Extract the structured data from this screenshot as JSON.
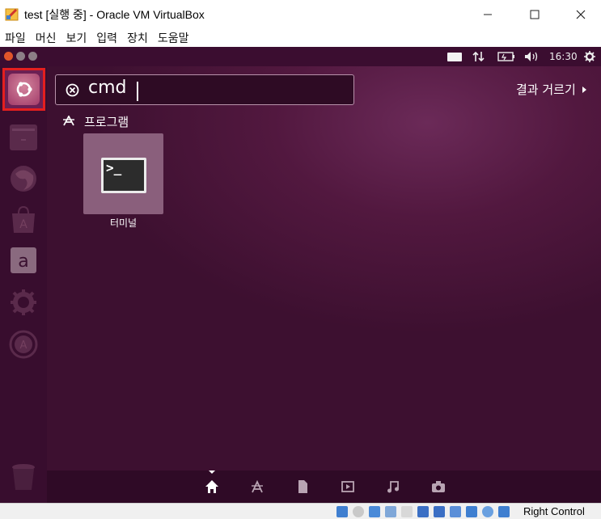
{
  "window": {
    "title": "test [실행 중] - Oracle VM VirtualBox",
    "controls": {
      "minimize": "—",
      "maximize": "☐",
      "close": "✕"
    }
  },
  "menubar": {
    "items": [
      "파일",
      "머신",
      "보기",
      "입력",
      "장치",
      "도움말"
    ]
  },
  "panel": {
    "clock": "16:30"
  },
  "dash": {
    "search_value": "cmd",
    "filter_label": "결과 거르기",
    "category": "프로그램",
    "results": [
      {
        "label": "터미널",
        "icon": "terminal-icon",
        "prompt": ">_"
      }
    ]
  },
  "launcher": {
    "items": [
      "ubuntu-logo-icon",
      "files-icon",
      "firefox-icon",
      "software-center-icon",
      "amazon-icon",
      "settings-icon",
      "updates-icon",
      "trash-icon"
    ],
    "amazon_glyph": "a"
  },
  "lens_bar": {
    "items": [
      "home-lens-icon",
      "applications-lens-icon",
      "files-lens-icon",
      "video-lens-icon",
      "music-lens-icon",
      "photo-lens-icon"
    ]
  },
  "statusbar": {
    "host_key": "Right Control"
  },
  "colors": {
    "accent_red": "#e41f1f",
    "dash_purple": "#52183f",
    "launcher": "#380d2e"
  }
}
